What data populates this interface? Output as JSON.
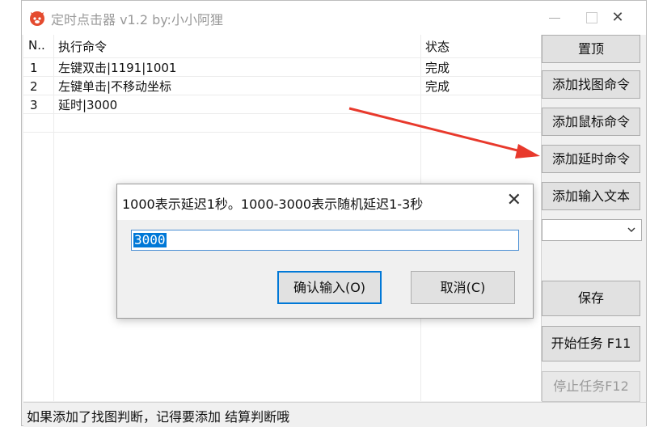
{
  "window": {
    "title": "定时点击器 v1.2 by:小小阿狸",
    "close_glyph": "✕"
  },
  "list": {
    "headers": [
      "N..",
      "执行命令",
      "状态"
    ],
    "rows": [
      {
        "n": "1",
        "cmd": "左键双击|1191|1001",
        "status": "完成"
      },
      {
        "n": "2",
        "cmd": "左键单击|不移动坐标",
        "status": "完成"
      },
      {
        "n": "3",
        "cmd": "延时|3000",
        "status": ""
      }
    ]
  },
  "sidebar": {
    "topmost": "置顶",
    "add_image": "添加找图命令",
    "add_mouse": "添加鼠标命令",
    "add_delay": "添加延时命令",
    "add_text": "添加输入文本",
    "combo_value": "",
    "save": "保存",
    "start": "开始任务 F11",
    "stop": "停止任务F12"
  },
  "status_bar": {
    "text": "如果添加了找图判断，记得要添加 结算判断哦"
  },
  "dialog": {
    "title": "1000表示延迟1秒。1000-3000表示随机延迟1-3秒",
    "close_glyph": "✕",
    "input_value": "3000",
    "ok_label": "确认输入(O)",
    "cancel_label": "取消(C)"
  },
  "colors": {
    "annotation_arrow": "#e8392c",
    "selection": "#0078d7"
  }
}
